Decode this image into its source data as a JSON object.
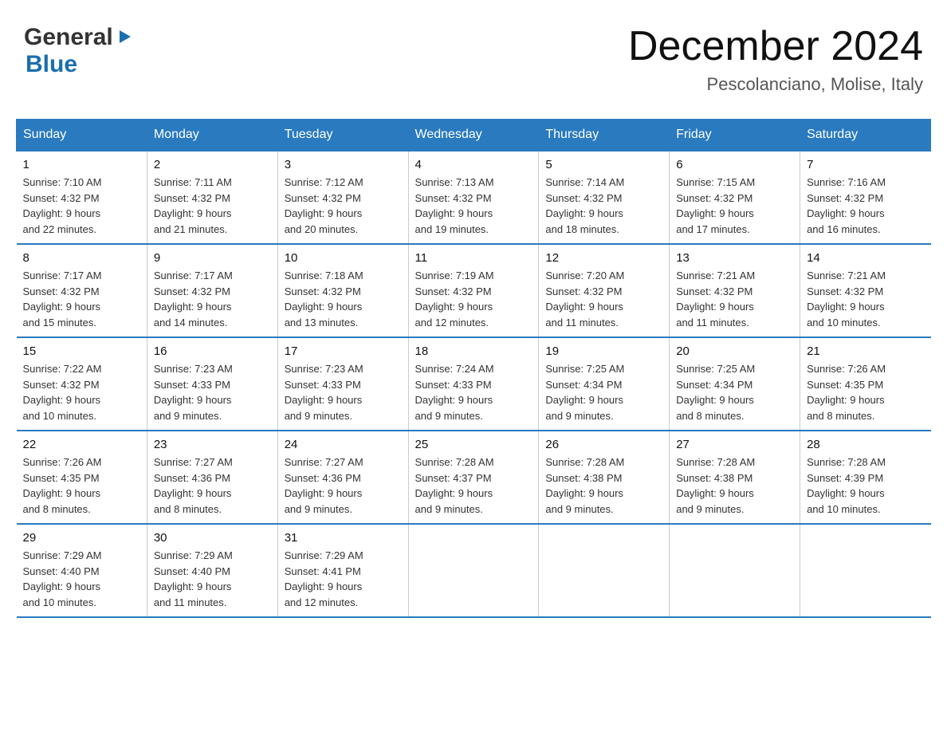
{
  "header": {
    "logo": {
      "general": "General",
      "blue": "Blue",
      "arrow": "▶"
    },
    "title": "December 2024",
    "location": "Pescolanciano, Molise, Italy"
  },
  "weekdays": [
    "Sunday",
    "Monday",
    "Tuesday",
    "Wednesday",
    "Thursday",
    "Friday",
    "Saturday"
  ],
  "weeks": [
    [
      {
        "day": "1",
        "sunrise": "7:10 AM",
        "sunset": "4:32 PM",
        "daylight": "9 hours and 22 minutes."
      },
      {
        "day": "2",
        "sunrise": "7:11 AM",
        "sunset": "4:32 PM",
        "daylight": "9 hours and 21 minutes."
      },
      {
        "day": "3",
        "sunrise": "7:12 AM",
        "sunset": "4:32 PM",
        "daylight": "9 hours and 20 minutes."
      },
      {
        "day": "4",
        "sunrise": "7:13 AM",
        "sunset": "4:32 PM",
        "daylight": "9 hours and 19 minutes."
      },
      {
        "day": "5",
        "sunrise": "7:14 AM",
        "sunset": "4:32 PM",
        "daylight": "9 hours and 18 minutes."
      },
      {
        "day": "6",
        "sunrise": "7:15 AM",
        "sunset": "4:32 PM",
        "daylight": "9 hours and 17 minutes."
      },
      {
        "day": "7",
        "sunrise": "7:16 AM",
        "sunset": "4:32 PM",
        "daylight": "9 hours and 16 minutes."
      }
    ],
    [
      {
        "day": "8",
        "sunrise": "7:17 AM",
        "sunset": "4:32 PM",
        "daylight": "9 hours and 15 minutes."
      },
      {
        "day": "9",
        "sunrise": "7:17 AM",
        "sunset": "4:32 PM",
        "daylight": "9 hours and 14 minutes."
      },
      {
        "day": "10",
        "sunrise": "7:18 AM",
        "sunset": "4:32 PM",
        "daylight": "9 hours and 13 minutes."
      },
      {
        "day": "11",
        "sunrise": "7:19 AM",
        "sunset": "4:32 PM",
        "daylight": "9 hours and 12 minutes."
      },
      {
        "day": "12",
        "sunrise": "7:20 AM",
        "sunset": "4:32 PM",
        "daylight": "9 hours and 11 minutes."
      },
      {
        "day": "13",
        "sunrise": "7:21 AM",
        "sunset": "4:32 PM",
        "daylight": "9 hours and 11 minutes."
      },
      {
        "day": "14",
        "sunrise": "7:21 AM",
        "sunset": "4:32 PM",
        "daylight": "9 hours and 10 minutes."
      }
    ],
    [
      {
        "day": "15",
        "sunrise": "7:22 AM",
        "sunset": "4:32 PM",
        "daylight": "9 hours and 10 minutes."
      },
      {
        "day": "16",
        "sunrise": "7:23 AM",
        "sunset": "4:33 PM",
        "daylight": "9 hours and 9 minutes."
      },
      {
        "day": "17",
        "sunrise": "7:23 AM",
        "sunset": "4:33 PM",
        "daylight": "9 hours and 9 minutes."
      },
      {
        "day": "18",
        "sunrise": "7:24 AM",
        "sunset": "4:33 PM",
        "daylight": "9 hours and 9 minutes."
      },
      {
        "day": "19",
        "sunrise": "7:25 AM",
        "sunset": "4:34 PM",
        "daylight": "9 hours and 9 minutes."
      },
      {
        "day": "20",
        "sunrise": "7:25 AM",
        "sunset": "4:34 PM",
        "daylight": "9 hours and 8 minutes."
      },
      {
        "day": "21",
        "sunrise": "7:26 AM",
        "sunset": "4:35 PM",
        "daylight": "9 hours and 8 minutes."
      }
    ],
    [
      {
        "day": "22",
        "sunrise": "7:26 AM",
        "sunset": "4:35 PM",
        "daylight": "9 hours and 8 minutes."
      },
      {
        "day": "23",
        "sunrise": "7:27 AM",
        "sunset": "4:36 PM",
        "daylight": "9 hours and 8 minutes."
      },
      {
        "day": "24",
        "sunrise": "7:27 AM",
        "sunset": "4:36 PM",
        "daylight": "9 hours and 9 minutes."
      },
      {
        "day": "25",
        "sunrise": "7:28 AM",
        "sunset": "4:37 PM",
        "daylight": "9 hours and 9 minutes."
      },
      {
        "day": "26",
        "sunrise": "7:28 AM",
        "sunset": "4:38 PM",
        "daylight": "9 hours and 9 minutes."
      },
      {
        "day": "27",
        "sunrise": "7:28 AM",
        "sunset": "4:38 PM",
        "daylight": "9 hours and 9 minutes."
      },
      {
        "day": "28",
        "sunrise": "7:28 AM",
        "sunset": "4:39 PM",
        "daylight": "9 hours and 10 minutes."
      }
    ],
    [
      {
        "day": "29",
        "sunrise": "7:29 AM",
        "sunset": "4:40 PM",
        "daylight": "9 hours and 10 minutes."
      },
      {
        "day": "30",
        "sunrise": "7:29 AM",
        "sunset": "4:40 PM",
        "daylight": "9 hours and 11 minutes."
      },
      {
        "day": "31",
        "sunrise": "7:29 AM",
        "sunset": "4:41 PM",
        "daylight": "9 hours and 12 minutes."
      },
      null,
      null,
      null,
      null
    ]
  ],
  "labels": {
    "sunrise_prefix": "Sunrise: ",
    "sunset_prefix": "Sunset: ",
    "daylight_prefix": "Daylight: "
  }
}
